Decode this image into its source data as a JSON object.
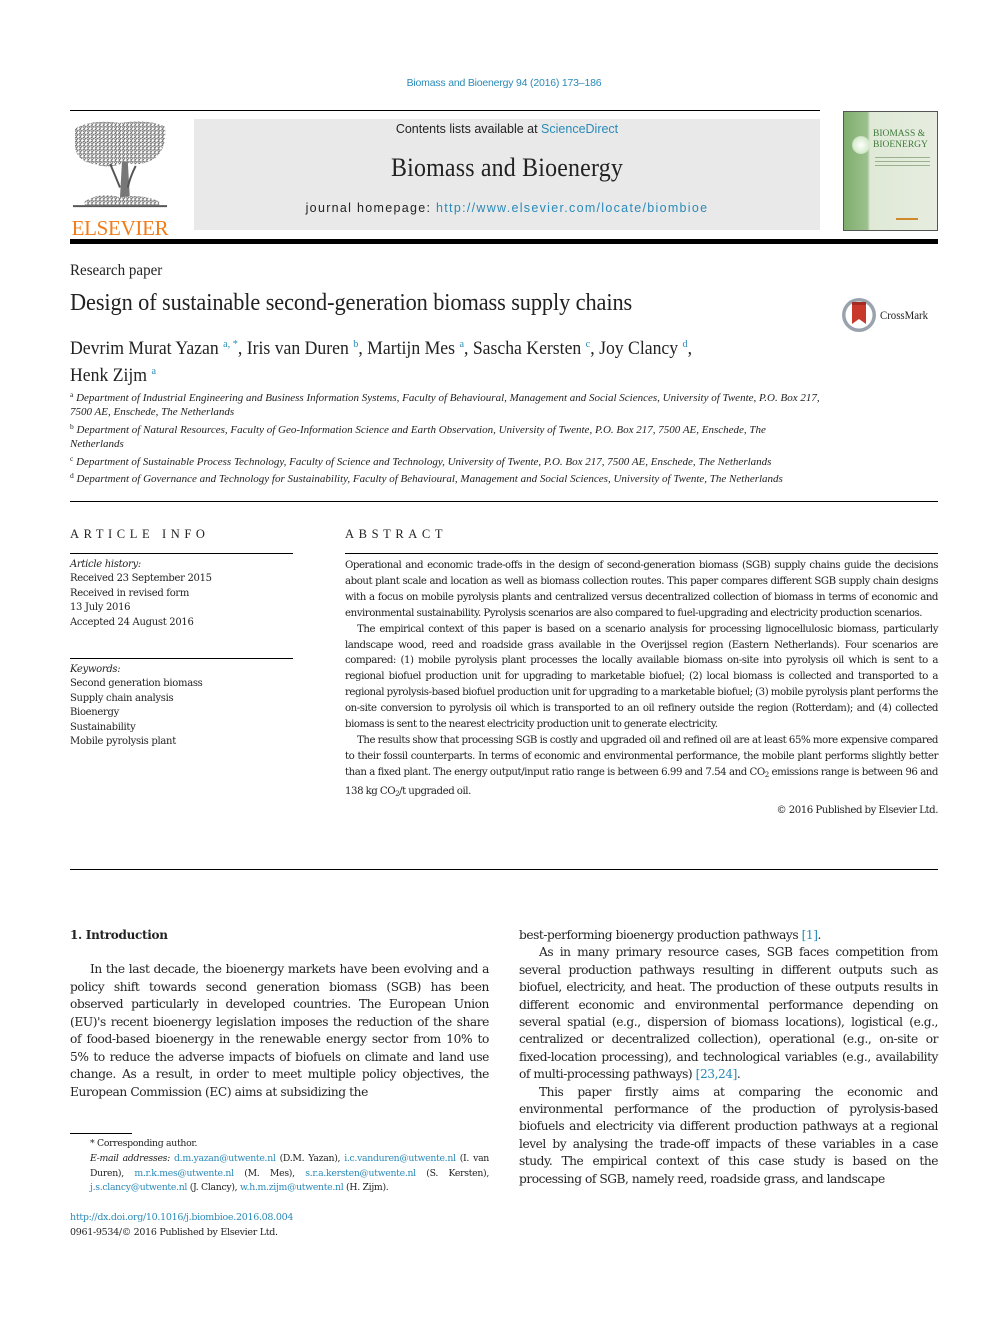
{
  "header": {
    "journal_citation": "Biomass and Bioenergy 94 (2016) 173–186",
    "contents_prefix": "Contents lists available at ",
    "contents_link": "ScienceDirect",
    "journal_name": "Biomass and Bioenergy",
    "homepage_prefix": "journal homepage: ",
    "homepage_url": "http://www.elsevier.com/locate/biombioe",
    "publisher_logo_text": "ELSEVIER",
    "cover_title_line1": "BIOMASS &",
    "cover_title_line2": "BIOENERGY"
  },
  "article": {
    "type": "Research paper",
    "title": "Design of sustainable second-generation biomass supply chains",
    "crossmark_label": "CrossMark",
    "authors": [
      {
        "name": "Devrim Murat Yazan",
        "sup": "a, *",
        "sep": ", "
      },
      {
        "name": "Iris van Duren",
        "sup": "b",
        "sep": ", "
      },
      {
        "name": "Martijn Mes",
        "sup": "a",
        "sep": ", "
      },
      {
        "name": "Sascha Kersten",
        "sup": "c",
        "sep": ", "
      },
      {
        "name": "Joy Clancy",
        "sup": "d",
        "sep": ","
      },
      {
        "name": "Henk Zijm",
        "sup": "a",
        "sep": ""
      }
    ],
    "affiliations": [
      {
        "key": "a",
        "text": "Department of Industrial Engineering and Business Information Systems, Faculty of Behavioural, Management and Social Sciences, University of Twente, P.O. Box 217, 7500 AE, Enschede, The Netherlands"
      },
      {
        "key": "b",
        "text": "Department of Natural Resources, Faculty of Geo-Information Science and Earth Observation, University of Twente, P.O. Box 217, 7500 AE, Enschede, The Netherlands"
      },
      {
        "key": "c",
        "text": "Department of Sustainable Process Technology, Faculty of Science and Technology, University of Twente, P.O. Box 217, 7500 AE, Enschede, The Netherlands"
      },
      {
        "key": "d",
        "text": "Department of Governance and Technology for Sustainability, Faculty of Behavioural, Management and Social Sciences, University of Twente, The Netherlands"
      }
    ]
  },
  "article_info": {
    "heading": "ARTICLE INFO",
    "history_label": "Article history:",
    "history": [
      "Received 23 September 2015",
      "Received in revised form",
      "13 July 2016",
      "Accepted 24 August 2016"
    ],
    "keywords_label": "Keywords:",
    "keywords": [
      "Second generation biomass",
      "Supply chain analysis",
      "Bioenergy",
      "Sustainability",
      "Mobile pyrolysis plant"
    ]
  },
  "abstract": {
    "heading": "ABSTRACT",
    "p1": "Operational and economic trade-offs in the design of second-generation biomass (SGB) supply chains guide the decisions about plant scale and location as well as biomass collection routes. This paper compares different SGB supply chain designs with a focus on mobile pyrolysis plants and centralized versus decentralized collection of biomass in terms of economic and environmental sustainability. Pyrolysis scenarios are also compared to fuel-upgrading and electricity production scenarios.",
    "p2": "The empirical context of this paper is based on a scenario analysis for processing lignocellulosic biomass, particularly landscape wood, reed and roadside grass available in the Overijssel region (Eastern Netherlands). Four scenarios are compared: (1) mobile pyrolysis plant processes the locally available biomass on-site into pyrolysis oil which is sent to a regional biofuel production unit for upgrading to marketable biofuel; (2) local biomass is collected and transported to a regional pyrolysis-based biofuel production unit for upgrading to a marketable biofuel; (3) mobile pyrolysis plant performs the on-site conversion to pyrolysis oil which is transported to an oil refinery outside the region (Rotterdam); and (4) collected biomass is sent to the nearest electricity production unit to generate electricity.",
    "p3_a": "The results show that processing SGB is costly and upgraded oil and refined oil are at least 65% more expensive compared to their fossil counterparts. In terms of economic and environmental performance, the mobile plant performs slightly better than a fixed plant. The energy output/input ratio range is between 6.99 and 7.54 and CO",
    "p3_sub1": "2",
    "p3_b": " emissions range is between 96 and 138 kg CO",
    "p3_sub2": "2",
    "p3_c": "/t upgraded oil.",
    "copyright": "© 2016 Published by Elsevier Ltd."
  },
  "body": {
    "section_title": "1.  Introduction",
    "left_p1": "In the last decade, the bioenergy markets have been evolving and a policy shift towards second generation biomass (SGB) has been observed particularly in developed countries. The European Union (EU)'s recent bioenergy legislation imposes the reduction of the share of food-based bioenergy in the renewable energy sector from 10% to 5% to reduce the adverse impacts of biofuels on climate and land use change. As a result, in order to meet multiple policy objectives, the European Commission (EC) aims at subsidizing the",
    "right_p0": "best-performing bioenergy production pathways ",
    "right_p0_ref": "[1]",
    "right_p0_end": ".",
    "right_p1": "As in many primary resource cases, SGB faces competition from several production pathways resulting in different outputs such as biofuel, electricity, and heat. The production of these outputs results in different economic and environmental performance depending on several spatial (e.g., dispersion of biomass locations), logistical (e.g., centralized or decentralized collection), operational (e.g., on-site or fixed-location processing), and technological variables (e.g., availability of multi-processing pathways) ",
    "right_p1_ref": "[23,24]",
    "right_p1_end": ".",
    "right_p2": "This paper firstly aims at comparing the economic and environmental performance of the production of pyrolysis-based biofuels and electricity via different production pathways at a regional level by analysing the trade-off impacts of these variables in a case study. The empirical context of this case study is based on the processing of SGB, namely reed, roadside grass, and landscape"
  },
  "footnotes": {
    "corresponding": "* Corresponding author.",
    "email_label": "E-mail addresses:",
    "emails": [
      {
        "addr": "d.m.yazan@utwente.nl",
        "who": " (D.M. Yazan), "
      },
      {
        "addr": "i.c.vanduren@utwente.nl",
        "who": " (I. van Duren), "
      },
      {
        "addr": "m.r.k.mes@utwente.nl",
        "who": " (M. Mes), "
      },
      {
        "addr": "s.r.a.kersten@utwente.nl",
        "who": " (S. Kersten), "
      },
      {
        "addr": "j.s.clancy@utwente.nl",
        "who": " (J. Clancy), "
      },
      {
        "addr": "w.h.m.zijm@utwente.nl",
        "who": " (H. Zijm)."
      }
    ],
    "doi": "http://dx.doi.org/10.1016/j.biombioe.2016.08.004",
    "issn": "0961-9534/© 2016 Published by Elsevier Ltd."
  }
}
